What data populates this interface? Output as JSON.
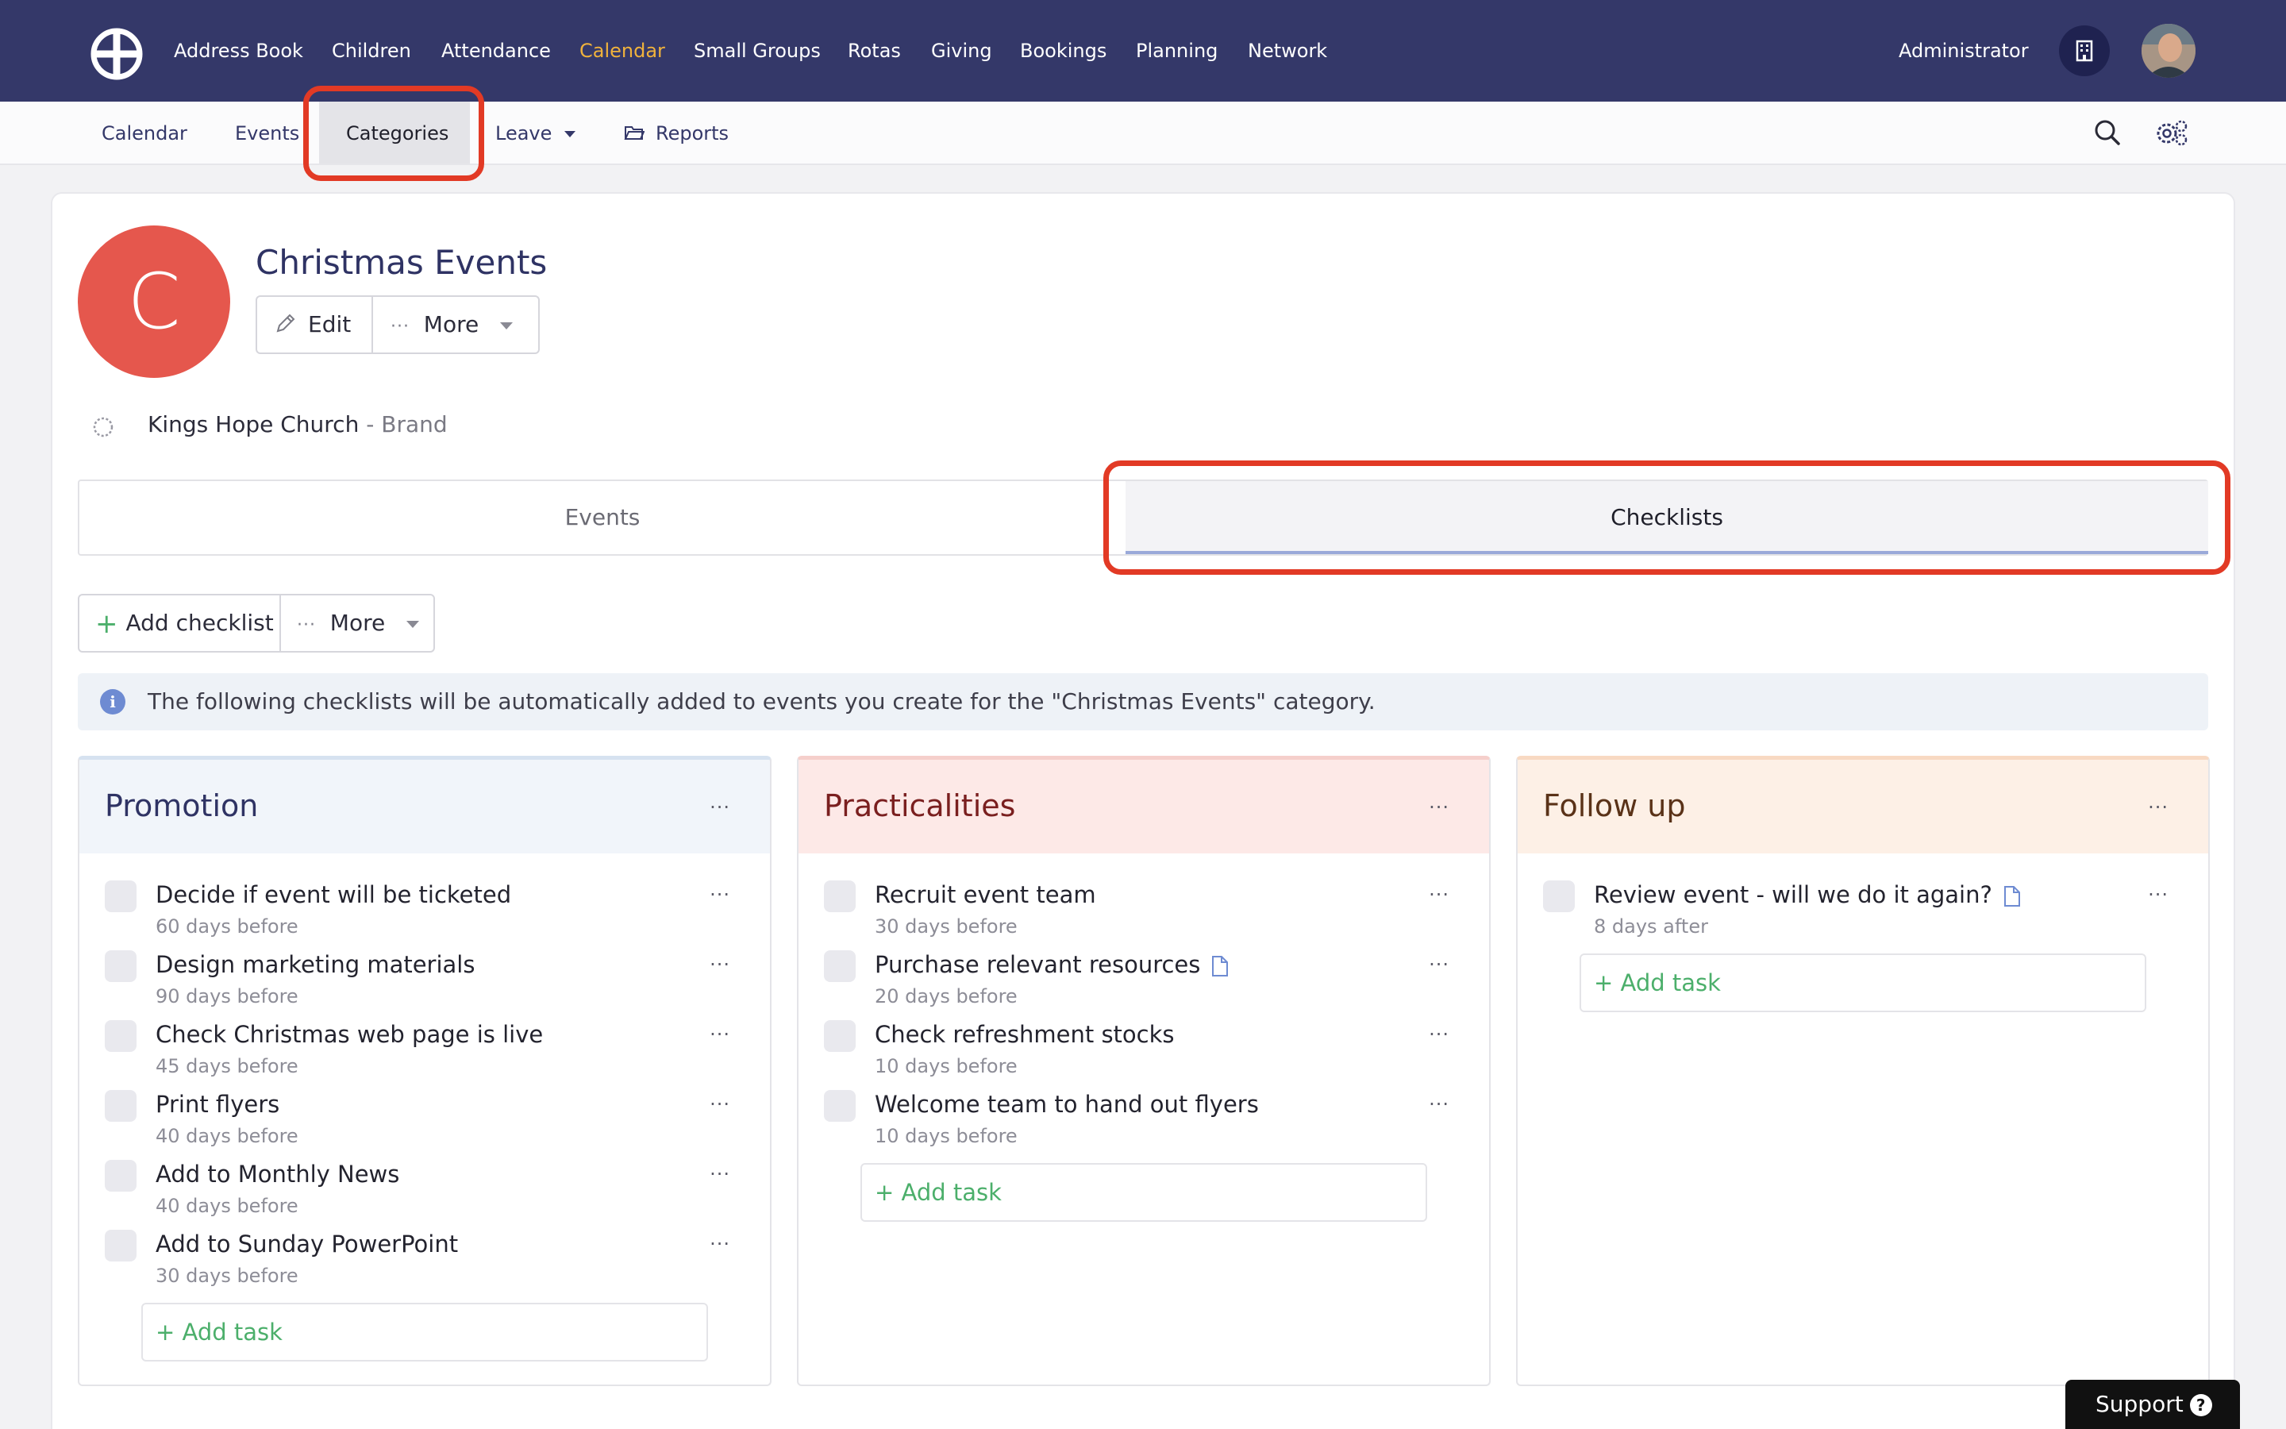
{
  "topnav": {
    "items": [
      "Address Book",
      "Children",
      "Attendance",
      "Calendar",
      "Small Groups",
      "Rotas",
      "Giving",
      "Bookings",
      "Planning",
      "Network"
    ],
    "active": "Calendar",
    "user_label": "Administrator"
  },
  "subnav": {
    "items": [
      "Calendar",
      "Events",
      "Categories",
      "Leave",
      "Reports"
    ],
    "active": "Categories"
  },
  "category": {
    "initial": "C",
    "title": "Christmas Events",
    "edit_label": "Edit",
    "more_label": "More",
    "brand_name": "Kings Hope Church",
    "brand_suffix": " - Brand"
  },
  "tabs": [
    "Events",
    "Checklists"
  ],
  "active_tab": "Checklists",
  "toolbar": {
    "add_label": "Add checklist",
    "more_label": "More"
  },
  "info_message": "The following checklists will be automatically added to events you create for the \"Christmas Events\" category.",
  "checklists": [
    {
      "title": "Promotion",
      "tasks": [
        {
          "name": "Decide if event will be ticketed",
          "timing": "60 days before"
        },
        {
          "name": "Design marketing materials",
          "timing": "90 days before"
        },
        {
          "name": "Check Christmas web page is live",
          "timing": "45 days before"
        },
        {
          "name": "Print flyers",
          "timing": "40 days before"
        },
        {
          "name": "Add to Monthly News",
          "timing": "40 days before"
        },
        {
          "name": "Add to Sunday PowerPoint",
          "timing": "30 days before"
        }
      ],
      "add_label": "+ Add task"
    },
    {
      "title": "Practicalities",
      "tasks": [
        {
          "name": "Recruit event team",
          "timing": "30 days before"
        },
        {
          "name": "Purchase relevant resources",
          "timing": "20 days before"
        },
        {
          "name": "Check refreshment stocks",
          "timing": "10 days before"
        },
        {
          "name": "Welcome team to hand out flyers",
          "timing": "10 days before"
        }
      ],
      "add_label": "+ Add task"
    },
    {
      "title": "Follow up",
      "tasks": [
        {
          "name": "Review event - will we do it again?",
          "timing": "8 days after"
        }
      ],
      "add_label": "+ Add task"
    }
  ],
  "support_label": "Support",
  "colors": {
    "nav_bg": "#343869",
    "nav_active": "#f0b23c",
    "avatar_red": "#e5574d",
    "highlight_red": "#e23a25",
    "promotion_head": "#f1f5fa",
    "practicalities_head": "#fde9e7",
    "followup_head": "#fdf0e6",
    "add_task_green": "#4caf6b"
  }
}
